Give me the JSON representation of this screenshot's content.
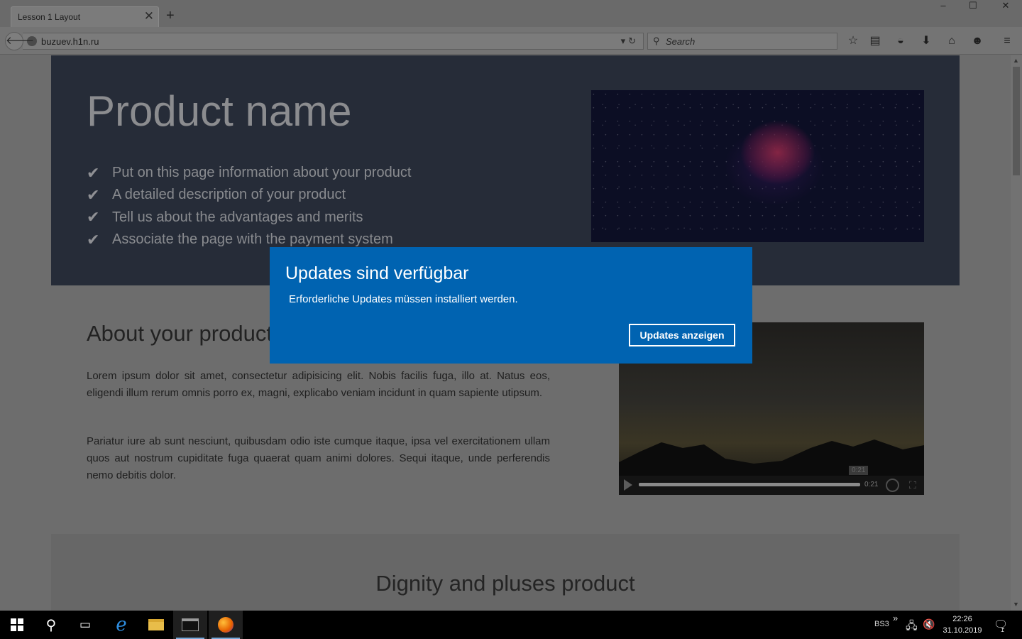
{
  "browser": {
    "tab_title": "Lesson 1 Layout",
    "tab_close": "✕",
    "new_tab": "+",
    "url": "buzuev.h1n.ru",
    "search_placeholder": "Search"
  },
  "window_controls": {
    "minimize": "–",
    "maximize": "☐",
    "close": "✕"
  },
  "toolbar_icons": [
    "bookmark-star-icon",
    "reading-list-icon",
    "pocket-icon",
    "download-icon",
    "home-icon",
    "chat-icon",
    "menu-icon"
  ],
  "page": {
    "hero": {
      "title": "Product name",
      "features": [
        "Put on this page information about your product",
        "A detailed description of your product",
        "Tell us about the advantages and merits",
        "Associate the page with the payment system"
      ]
    },
    "about": {
      "title": "About your product",
      "paragraphs": [
        "Lorem ipsum dolor sit amet, consectetur adipisicing elit. Nobis facilis fuga, illo at. Natus eos, eligendi illum rerum omnis porro ex, magni, explicabo veniam incidunt in quam sapiente utipsum.",
        "Pariatur iure ab sunt nesciunt, quibusdam odio iste cumque itaque, ipsa vel exercitationem ullam quos aut nostrum cupiditate fuga quaerat quam animi dolores. Sequi itaque, unde perferendis nemo debitis dolor."
      ]
    },
    "video": {
      "time": "0:21",
      "tooltip_time": "0:21",
      "progress": 1.0
    },
    "dignity": {
      "title": "Dignity and pluses product"
    }
  },
  "dialog": {
    "title": "Updates sind verfügbar",
    "message": "Erforderliche Updates müssen installiert werden.",
    "button": "Updates anzeigen"
  },
  "taskbar": {
    "keyboard_layout": "BS3",
    "overflow": "»",
    "time": "22:26",
    "date": "31.10.2019",
    "notification_count": "1"
  },
  "colors": {
    "dialog_bg": "#0063b1",
    "hero_bg": "#262c38",
    "taskbar_bg": "#000000"
  }
}
